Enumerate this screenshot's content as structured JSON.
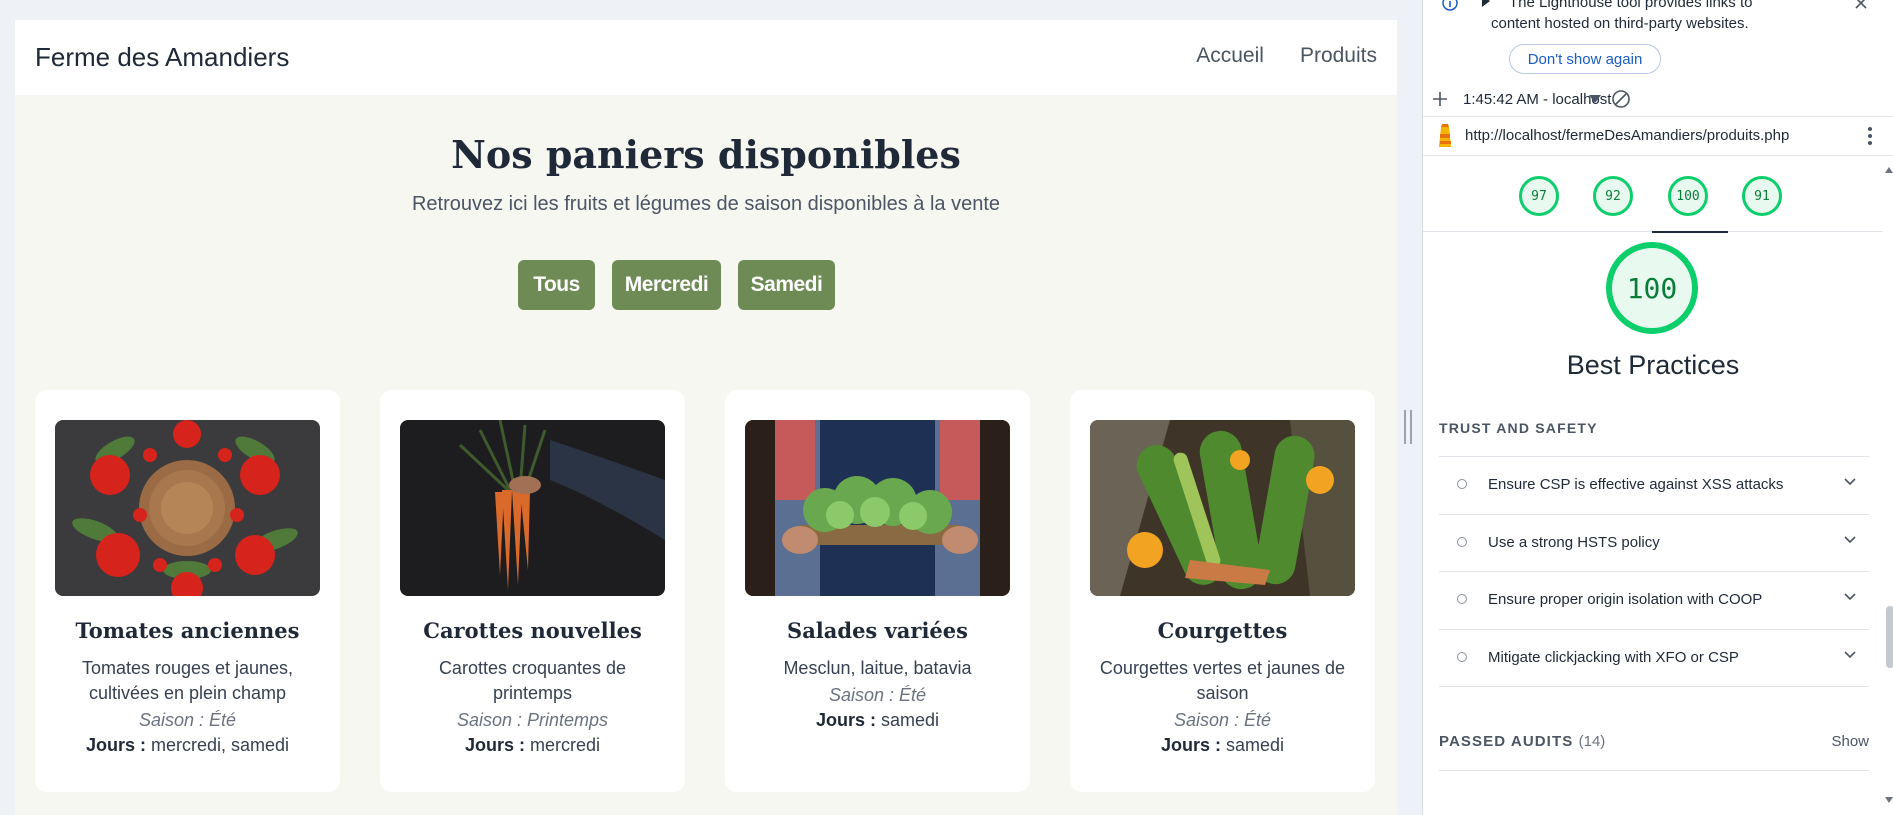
{
  "site": {
    "brand": "Ferme des Amandiers",
    "nav": [
      "Accueil",
      "Produits"
    ],
    "hero_title": "Nos paniers disponibles",
    "hero_subtitle": "Retrouvez ici les fruits et légumes de saison disponibles à la vente",
    "filters": [
      "Tous",
      "Mercredi",
      "Samedi"
    ],
    "products": [
      {
        "title": "Tomates anciennes",
        "description": "Tomates rouges et jaunes, cultivées en plein champ",
        "season": "Saison : Été",
        "days_label": "Jours :",
        "days": "mercredi, samedi"
      },
      {
        "title": "Carottes nouvelles",
        "description": "Carottes croquantes de printemps",
        "season": "Saison : Printemps",
        "days_label": "Jours :",
        "days": "mercredi"
      },
      {
        "title": "Salades variées",
        "description": "Mesclun, laitue, batavia",
        "season": "Saison : Été",
        "days_label": "Jours :",
        "days": "samedi"
      },
      {
        "title": "Courgettes",
        "description": "Courgettes vertes et jaunes de saison",
        "season": "Saison : Été",
        "days_label": "Jours :",
        "days": "samedi"
      }
    ],
    "colors": {
      "button": "#6e8b55",
      "background": "#f7f7f2"
    }
  },
  "devtools": {
    "banner_line1": "The Lighthouse tool provides links to",
    "banner_line2": "content hosted on third-party websites.",
    "dont_show_label": "Don't show again",
    "report_time": "1:45:42 AM - localhost",
    "url": "http://localhost/fermeDesAmandiers/produits.php",
    "scores": [
      "97",
      "92",
      "100",
      "91"
    ],
    "active_score": "100",
    "category": "Best Practices",
    "group_title": "TRUST AND SAFETY",
    "audits": [
      "Ensure CSP is effective against XSS attacks",
      "Use a strong HSTS policy",
      "Ensure proper origin isolation with COOP",
      "Mitigate clickjacking with XFO or CSP"
    ],
    "passed_label": "PASSED AUDITS",
    "passed_count": "(14)",
    "show_label": "Show",
    "colors": {
      "pass": "#0cce6b",
      "pass_text": "#0a7e38"
    }
  }
}
